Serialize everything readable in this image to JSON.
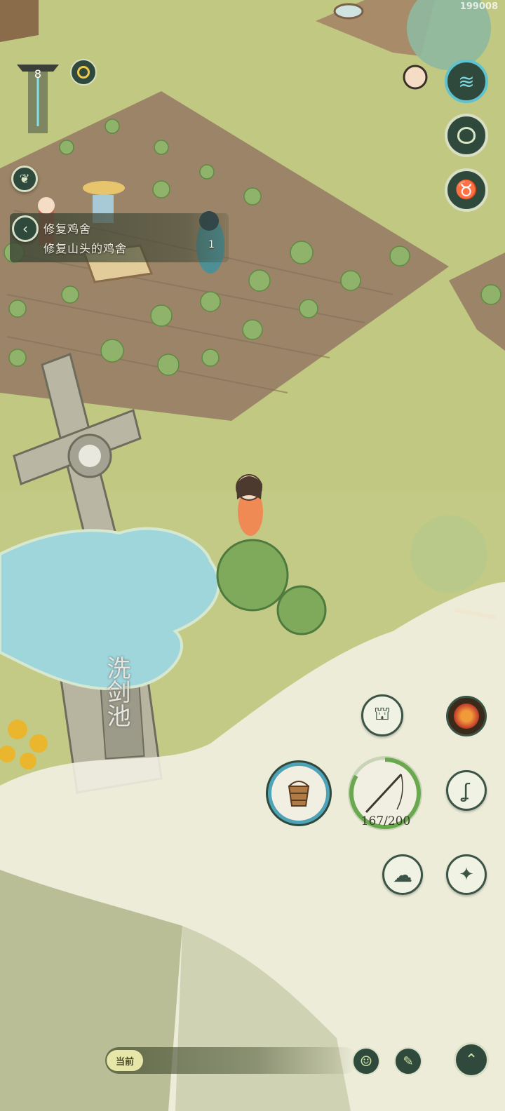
{
  "top": {
    "id_watermark": "199008",
    "level": "8"
  },
  "quest": {
    "title": "修复鸡舍",
    "description": "修复山头的鸡舍",
    "marker_number": "1"
  },
  "monument": {
    "label": "洗剑池"
  },
  "action": {
    "stamina": "167/200"
  },
  "chat": {
    "current_label": "当前"
  },
  "colors": {
    "grass": "#c9cf8e",
    "soil": "#9b8467",
    "water": "#9fd6dc",
    "button_dark": "#2f4a3c",
    "button_ring": "#4fa3b8",
    "progress_green": "#6aa84f"
  },
  "icons": {
    "right_column": [
      "wave-icon",
      "pot-icon",
      "ox-head-icon"
    ],
    "action_grid": [
      "seedling-box-icon",
      "demon-mask-icon",
      "bucket-icon",
      "fishing-rod-icon",
      "hook-icon",
      "cloud-icon",
      "compass-icon"
    ],
    "bottom": [
      "smile-icon",
      "edit-icon",
      "chevron-up-icon"
    ]
  }
}
